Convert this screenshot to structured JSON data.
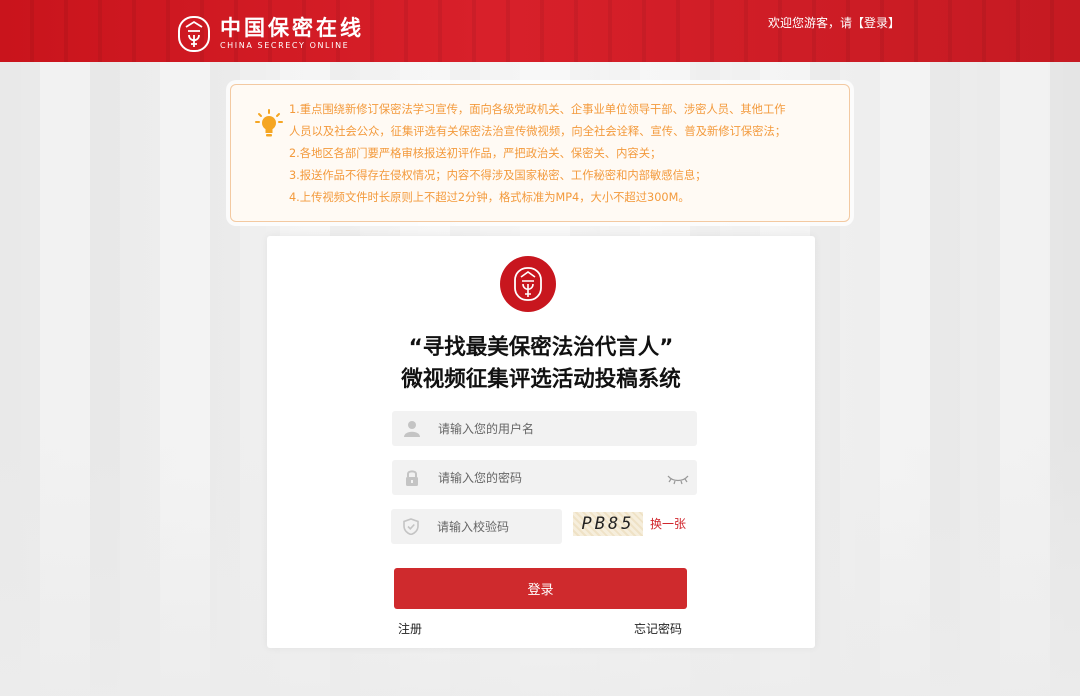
{
  "header": {
    "logo_cn": "中国保密在线",
    "logo_en": "CHINA SECRECY ONLINE",
    "welcome_text": "欢迎您游客，请【",
    "login_link": "登录",
    "welcome_end": "】",
    "background_color": "#d11c24"
  },
  "notice": {
    "lines": [
      "1.重点围绕新修订保密法学习宣传，面向各级党政机关、企事业单位领导干部、涉密人员、其他工作",
      "人员以及社会公众，征集评选有关保密法治宣传微视频，向全社会诠释、宣传、普及新修订保密法；",
      "2.各地区各部门要严格审核报送初评作品，严把政治关、保密关、内容关；",
      "3.报送作品不得存在侵权情况；内容不得涉及国家秘密、工作秘密和内部敏感信息；",
      "4.上传视频文件时长原则上不超过2分钟，格式标准为MP4，大小不超过300M。"
    ],
    "icon": "lightbulb-icon",
    "text_color": "#f39a3c"
  },
  "login": {
    "title_line1": "“寻找最美保密法治代言人”",
    "title_line2": "微视频征集评选活动投稿系统",
    "username_placeholder": "请输入您的用户名",
    "password_placeholder": "请输入您的密码",
    "code_placeholder": "请输入校验码",
    "captcha_text": "PB85",
    "refresh_label": "换一张",
    "login_button": "登录",
    "register_link": "注册",
    "forgot_link": "忘记密码",
    "accent_color": "#cf2a2d"
  }
}
